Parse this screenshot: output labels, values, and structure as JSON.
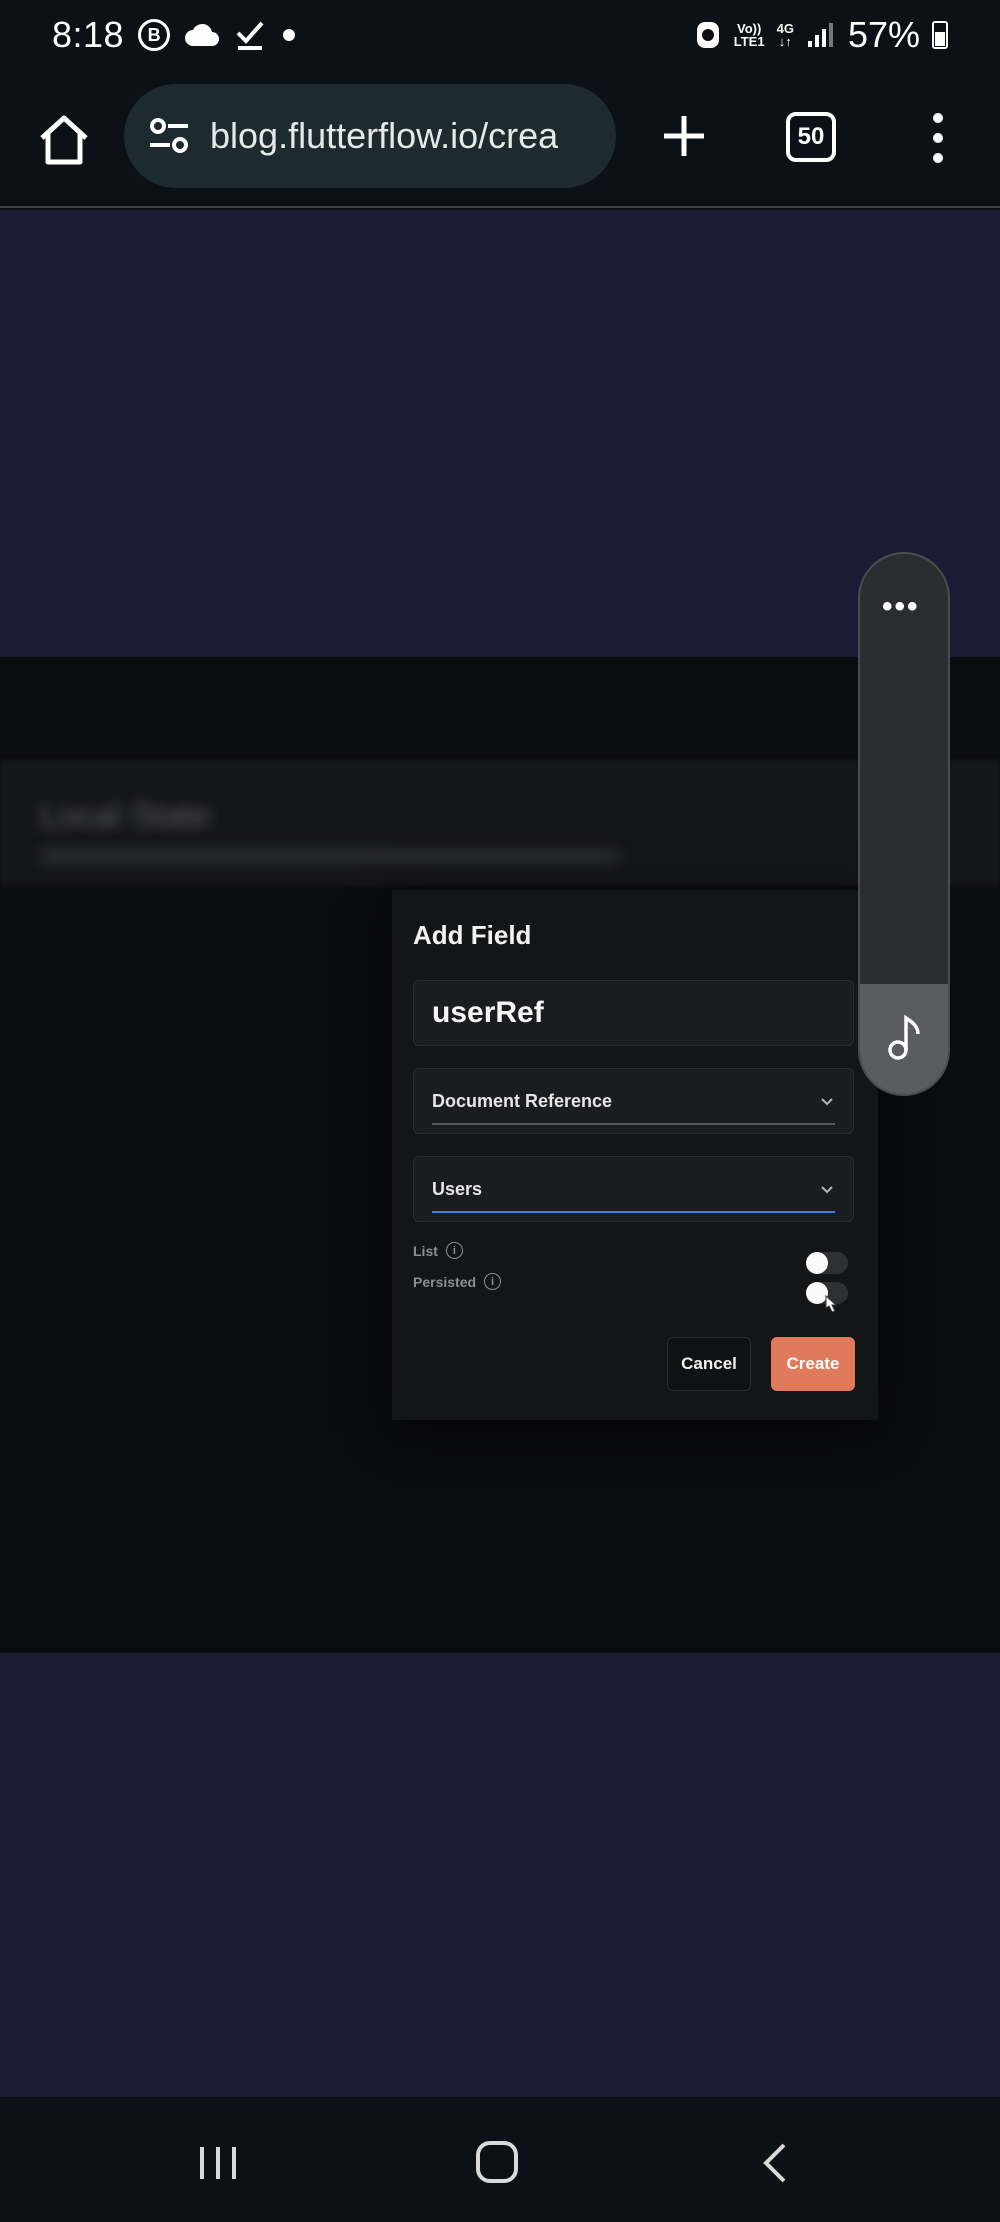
{
  "status_bar": {
    "time": "8:18",
    "icons": [
      "b-badge-icon",
      "cloud-icon",
      "check-icon",
      "dot-icon",
      "sync-icon",
      "volte-icon",
      "4g-icon",
      "signal-icon",
      "battery-icon"
    ],
    "volte_top": "Vo))",
    "volte_bottom": "LTE1",
    "network": "4G",
    "battery_percent": "57%"
  },
  "browser": {
    "url": "blog.flutterflow.io/crea",
    "tab_count": "50"
  },
  "page": {
    "blurred_heading": "Local State"
  },
  "dialog": {
    "title": "Add Field",
    "field_name_value": "userRef",
    "type_select": "Document Reference",
    "collection_select": "Users",
    "list_label": "List",
    "persisted_label": "Persisted",
    "list_toggle_on": false,
    "persisted_toggle_on": false,
    "cancel_label": "Cancel",
    "create_label": "Create"
  },
  "floating_panel": {
    "menu_label": "•••"
  },
  "colors": {
    "accent_create": "#e07a5b",
    "focus_underline": "#3d7cdf",
    "page_bg": "#1b1c34"
  }
}
